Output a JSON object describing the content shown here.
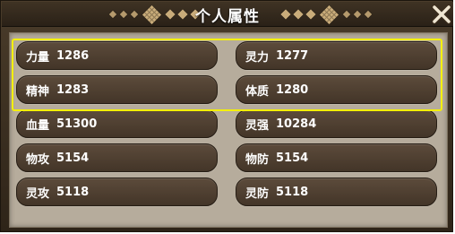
{
  "window": {
    "title": "个人属性",
    "close_icon": "close-x-icon",
    "accent_color": "#c9ac7a",
    "highlight_color": "#f4f000"
  },
  "stats": [
    {
      "name": "力量",
      "value": "1286"
    },
    {
      "name": "灵力",
      "value": "1277"
    },
    {
      "name": "精神",
      "value": "1283"
    },
    {
      "name": "体质",
      "value": "1280"
    },
    {
      "name": "血量",
      "value": "51300"
    },
    {
      "name": "灵强",
      "value": "10284"
    },
    {
      "name": "物攻",
      "value": "5154"
    },
    {
      "name": "物防",
      "value": "5154"
    },
    {
      "name": "灵攻",
      "value": "5118"
    },
    {
      "name": "灵防",
      "value": "5118"
    }
  ]
}
